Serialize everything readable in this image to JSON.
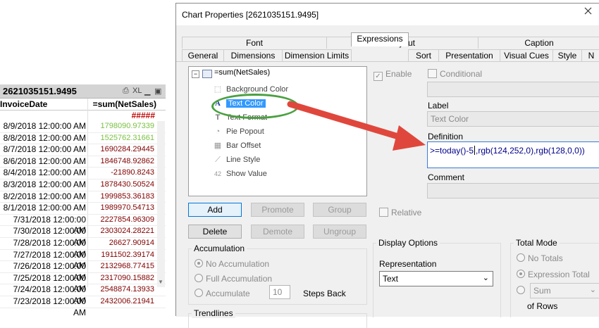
{
  "table": {
    "title": "2621035151.9495",
    "col_date": "InvoiceDate",
    "col_sales": "=sum(NetSales)",
    "totals": "#####",
    "icon_xl": "XL",
    "rows": [
      {
        "date": "8/9/2018 12:00:00 AM",
        "value": "1798090.97339",
        "color": "#7ac143"
      },
      {
        "date": "8/8/2018 12:00:00 AM",
        "value": "1525762.31661",
        "color": "#7ac143"
      },
      {
        "date": "8/7/2018 12:00:00 AM",
        "value": "1690284.29445",
        "color": "#800000"
      },
      {
        "date": "8/6/2018 12:00:00 AM",
        "value": "1846748.92862",
        "color": "#800000"
      },
      {
        "date": "8/4/2018 12:00:00 AM",
        "value": "-21890.8243",
        "color": "#800000"
      },
      {
        "date": "8/3/2018 12:00:00 AM",
        "value": "1878430.50524",
        "color": "#800000"
      },
      {
        "date": "8/2/2018 12:00:00 AM",
        "value": "1999853.36183",
        "color": "#800000"
      },
      {
        "date": "8/1/2018 12:00:00 AM",
        "value": "1989970.54713",
        "color": "#800000"
      },
      {
        "date": "7/31/2018 12:00:00 AM",
        "value": "2227854.96309",
        "color": "#800000"
      },
      {
        "date": "7/30/2018 12:00:00 AM",
        "value": "2303024.28221",
        "color": "#800000"
      },
      {
        "date": "7/28/2018 12:00:00 AM",
        "value": "26627.90914",
        "color": "#800000"
      },
      {
        "date": "7/27/2018 12:00:00 AM",
        "value": "1911502.39174",
        "color": "#800000"
      },
      {
        "date": "7/26/2018 12:00:00 AM",
        "value": "2132968.77415",
        "color": "#800000"
      },
      {
        "date": "7/25/2018 12:00:00 AM",
        "value": "2317090.15882",
        "color": "#800000"
      },
      {
        "date": "7/24/2018 12:00:00 AM",
        "value": "2548874.13933",
        "color": "#800000"
      },
      {
        "date": "7/23/2018 12:00:00 AM",
        "value": "2432006.21941",
        "color": "#800000"
      }
    ]
  },
  "dialog": {
    "title": "Chart Properties [2621035151.9495]",
    "tabs_top": [
      "Font",
      "Layout",
      "Caption"
    ],
    "tabs_bottom": [
      "General",
      "Dimensions",
      "Dimension Limits",
      "Expressions",
      "Sort",
      "Presentation",
      "Visual Cues",
      "Style",
      "N"
    ],
    "selected_tab": "Expressions",
    "tree": {
      "root": "=sum(NetSales)",
      "children": [
        "Background Color",
        "Text Color",
        "Text Format",
        "Pie Popout",
        "Bar Offset",
        "Line Style",
        "Show Value"
      ],
      "selected": "Text Color"
    },
    "buttons": {
      "add": "Add",
      "promote": "Promote",
      "group": "Group",
      "delete": "Delete",
      "demote": "Demote",
      "ungroup": "Ungroup"
    },
    "enable_label": "Enable",
    "conditional_label": "Conditional",
    "label_caption": "Label",
    "label_value": "Text Color",
    "definition_caption": "Definition",
    "definition_value": ">=today()-5,rgb(124,252,0),rgb(128,0,0))",
    "definition_parts": {
      "a": ">=today()-5",
      "b": ",rgb(124,252,0),rgb(128,0,0))"
    },
    "comment_caption": "Comment",
    "relative_label": "Relative",
    "accumulation": {
      "title": "Accumulation",
      "options": [
        "No Accumulation",
        "Full Accumulation",
        "Accumulate"
      ],
      "steps_value": "10",
      "steps_label": "Steps Back"
    },
    "trendlines_title": "Trendlines",
    "display_options": {
      "title": "Display Options",
      "representation_label": "Representation",
      "representation_value": "Text"
    },
    "total_mode": {
      "title": "Total Mode",
      "options": [
        "No Totals",
        "Expression Total"
      ],
      "sum_value": "Sum",
      "of_rows": "of Rows"
    }
  }
}
